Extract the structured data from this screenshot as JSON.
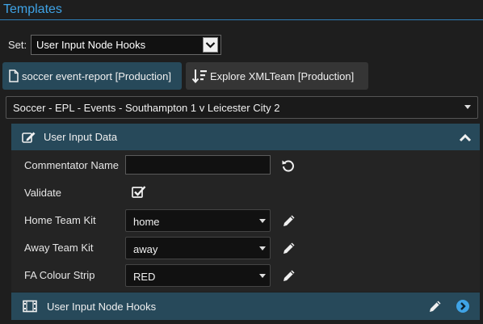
{
  "header": {
    "title": "Templates"
  },
  "set": {
    "label": "Set:",
    "selected": "User Input Node Hooks"
  },
  "buttons": {
    "soccer": "soccer event-report [Production]",
    "explore": "Explore XMLTeam [Production]"
  },
  "event_select": {
    "selected": "Soccer - EPL - Events - Southampton 1 v Leicester City 2"
  },
  "panel": {
    "title": "User Input Data",
    "fields": {
      "commentator": {
        "label": "Commentator Name",
        "value": ""
      },
      "validate": {
        "label": "Validate",
        "checked": true
      },
      "home_kit": {
        "label": "Home Team Kit",
        "value": "home"
      },
      "away_kit": {
        "label": "Away Team Kit",
        "value": "away"
      },
      "fa_strip": {
        "label": "FA Colour Strip",
        "value": "RED"
      }
    }
  },
  "footer": {
    "title": "User Input Node Hooks"
  },
  "colors": {
    "accent": "#3fa3e6",
    "panel": "#27495a",
    "background": "#1e1e1e"
  }
}
